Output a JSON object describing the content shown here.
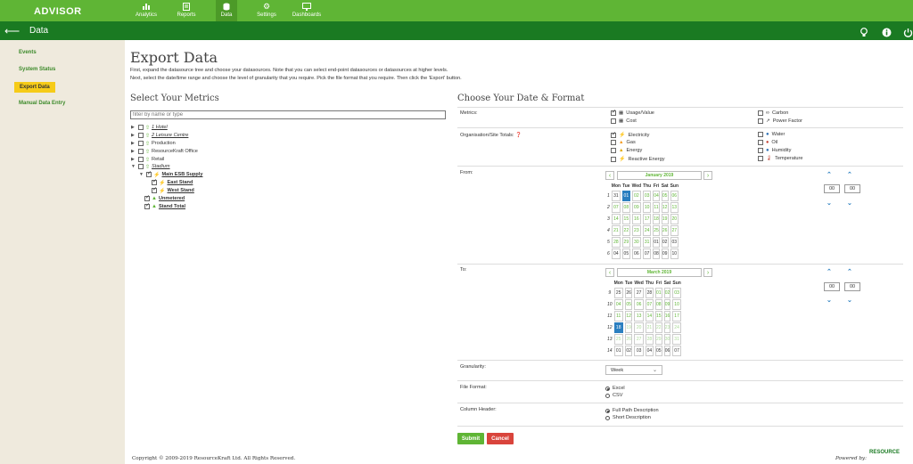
{
  "app": {
    "logo": "ADVISOR"
  },
  "nav": [
    {
      "label": "Analytics",
      "icon": "analytics-icon"
    },
    {
      "label": "Reports",
      "icon": "reports-icon"
    },
    {
      "label": "Data",
      "icon": "data-icon"
    },
    {
      "label": "Settings",
      "icon": "settings-icon"
    },
    {
      "label": "Dashboards",
      "icon": "dashboards-icon"
    }
  ],
  "subbar": {
    "title": "Data",
    "icons": [
      "lightbulb-icon",
      "info-icon",
      "power-icon"
    ]
  },
  "sidebar": [
    "Events",
    "System Status",
    "Export Data",
    "Manual Data Entry"
  ],
  "page": {
    "title": "Export Data",
    "intro1": "First, expand the datasource tree and choose your datasources. Note that you can select end-point datasources or datasources at higher levels.",
    "intro2": "Next, select the date/time range and choose the level of granularity that you require. Pick the file format that you require. Then click the 'Export' button.",
    "left_heading": "Select Your Metrics",
    "right_heading": "Choose Your Date & Format",
    "filter_placeholder": "filter by name or type"
  },
  "tree": [
    "1 Hotel",
    "2 Leisure Centre",
    "Production",
    "ResourceKraft Office",
    "Retail",
    "Stadium",
    "Main ESB Supply",
    "East Stand",
    "West Stand",
    "Unmetered",
    "Stand Total"
  ],
  "form": {
    "metrics_label": "Metrics:",
    "metrics": [
      "Usage/Value",
      "Cost",
      "Carbon",
      "Power Factor"
    ],
    "org_label": "Organisation/Site Totals:",
    "org": [
      "Electricity",
      "Gas",
      "Energy",
      "Reactive Energy",
      "Water",
      "Oil",
      "Humidity",
      "Temperature"
    ],
    "from_label": "From:",
    "to_label": "To:",
    "granularity_label": "Granularity:",
    "granularity_value": "Week",
    "file_label": "File Format:",
    "file_options": [
      "Excel",
      "CSV"
    ],
    "header_label": "Column Header:",
    "header_options": [
      "Full Path Description",
      "Short Description"
    ],
    "submit": "Submit",
    "cancel": "Cancel"
  },
  "days": [
    "Mon",
    "Tue",
    "Wed",
    "Thu",
    "Fri",
    "Sat",
    "Sun"
  ],
  "from_cal": {
    "month": "January 2019",
    "weeks": [
      "1",
      "2",
      "3",
      "4",
      "5",
      "6"
    ],
    "rows": [
      [
        "31",
        "01",
        "02",
        "03",
        "04",
        "05",
        "06"
      ],
      [
        "07",
        "08",
        "09",
        "10",
        "11",
        "12",
        "13"
      ],
      [
        "14",
        "15",
        "16",
        "17",
        "18",
        "19",
        "20"
      ],
      [
        "21",
        "22",
        "23",
        "24",
        "25",
        "26",
        "27"
      ],
      [
        "28",
        "29",
        "30",
        "31",
        "01",
        "02",
        "03"
      ],
      [
        "04",
        "05",
        "06",
        "07",
        "08",
        "09",
        "10"
      ]
    ],
    "hour": "00",
    "minute": "00"
  },
  "to_cal": {
    "month": "March 2019",
    "weeks": [
      "9",
      "10",
      "11",
      "12",
      "13",
      "14"
    ],
    "rows": [
      [
        "25",
        "26",
        "27",
        "28",
        "01",
        "02",
        "03"
      ],
      [
        "04",
        "05",
        "06",
        "07",
        "08",
        "09",
        "10"
      ],
      [
        "11",
        "12",
        "13",
        "14",
        "15",
        "16",
        "17"
      ],
      [
        "18",
        "19",
        "20",
        "21",
        "22",
        "23",
        "24"
      ],
      [
        "25",
        "26",
        "27",
        "28",
        "29",
        "30",
        "31"
      ],
      [
        "01",
        "02",
        "03",
        "04",
        "05",
        "06",
        "07"
      ]
    ],
    "hour": "00",
    "minute": "00"
  },
  "footer": {
    "copyright": "Copyright © 2009-2019 ResourceKraft Ltd. All Rights Reserved.",
    "powered": "Powered by:",
    "brand": "RESOURCE"
  }
}
